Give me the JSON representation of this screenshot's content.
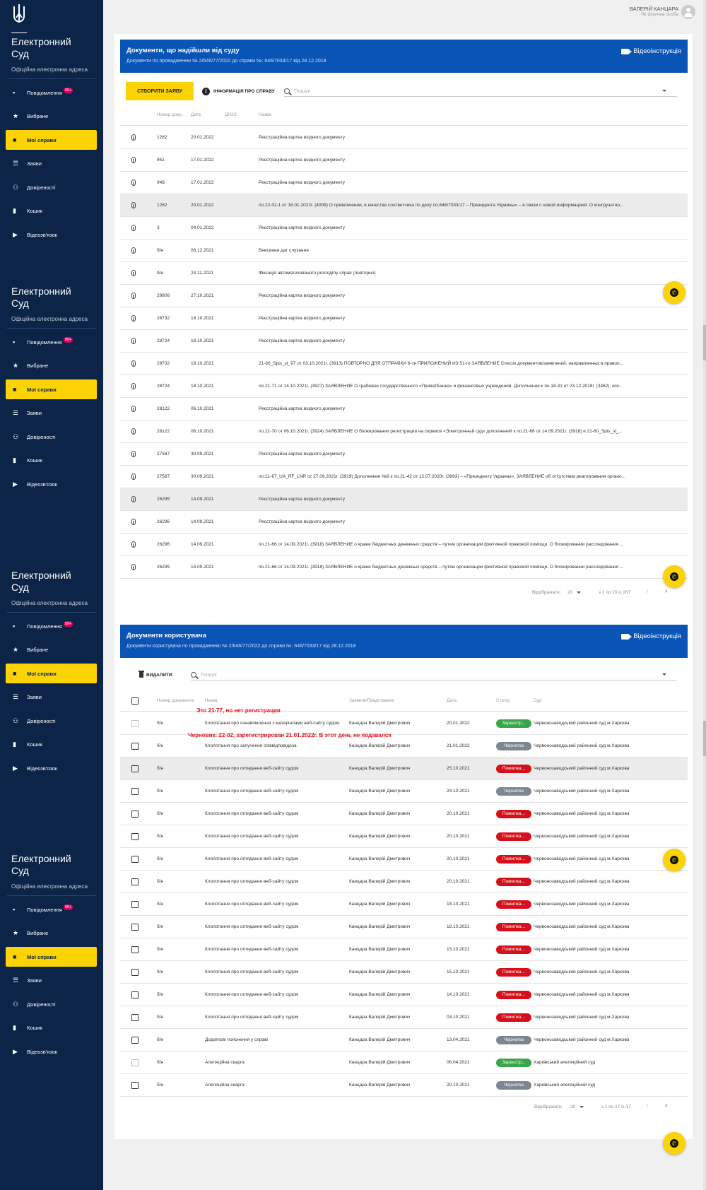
{
  "user": {
    "name": "ВАЛЕРІЙ КАНЦАРА",
    "role": "Як фізична особа"
  },
  "sidebar": {
    "title_line1": "Електронний",
    "title_line2": "Суд",
    "subtitle": "Офіційна електронна адреса",
    "badge": "99+",
    "items": [
      {
        "label": "Повідомлення",
        "icon": "message-icon"
      },
      {
        "label": "Вибране",
        "icon": "star-icon"
      },
      {
        "label": "Мої справи",
        "icon": "folder-icon",
        "active": true
      },
      {
        "label": "Заяви",
        "icon": "list-icon"
      },
      {
        "label": "Довіреності",
        "icon": "people-icon"
      },
      {
        "label": "Кошик",
        "icon": "trash-icon"
      },
      {
        "label": "Відеозв'язок",
        "icon": "video-icon"
      }
    ]
  },
  "court_docs": {
    "title": "Документи, що надійшли від суду",
    "subtitle": "Документи по провадженню № 2/646/77/2022 до справи №: 646/7033/17 від 28.12.2018",
    "video_label": "Відеоінструкція",
    "create_btn": "СТВОРИТИ ЗАЯВУ",
    "info_btn": "ІНФОРМАЦІЯ ПРО СПРАВУ",
    "search_placeholder": "Пошук",
    "columns": [
      "Номер доку...",
      "Дата",
      "ДНЗС",
      "Назва"
    ],
    "rows": [
      {
        "num": "1262",
        "date": "20.01.2022",
        "title": "Реєстраційна картка вхідного документу"
      },
      {
        "num": "951",
        "date": "17.01.2022",
        "title": "Реєстраційна картка вхідного документу"
      },
      {
        "num": "948",
        "date": "17.01.2022",
        "title": "Реєстраційна картка вхідного документу"
      },
      {
        "num": "1262",
        "date": "20.01.2022",
        "title": "по.22-02-1 от 16.01.2022г. (4009) О привлечении, в качестве соответчика по делу по.646/7033/17 – Президента Украины» – в связи с новой информацией. О конгруэнтно...",
        "sel": true
      },
      {
        "num": "3",
        "date": "04.01.2022",
        "title": "Реєстраційна картка вхідного документу"
      },
      {
        "num": "б/н",
        "date": "06.12.2021",
        "title": "Внесення дат слухання"
      },
      {
        "num": "б/н",
        "date": "24.11.2021",
        "title": "Фіксація автоматизованого розподілу справ (повторно)"
      },
      {
        "num": "29806",
        "date": "27.10.2021",
        "title": "Реєстраційна картка вхідного документу"
      },
      {
        "num": "28732",
        "date": "18.10.2021",
        "title": "Реєстраційна картка вхідного документу"
      },
      {
        "num": "28724",
        "date": "18.10.2021",
        "title": "Реєстраційна картка вхідного документу"
      },
      {
        "num": "28732",
        "date": "18.10.2021",
        "title": "21-60_Spis_st_97 от 03.10.2021г. (3913) ПОВТОРНО ДЛЯ ОТПРАВКИ 6-ти ПРИЛОЖЕНИЙ ИЗ 51-го ЗАЯВЛЕНИЕ Список документов/заявлений, направленных в правоо..."
      },
      {
        "num": "28724",
        "date": "18.10.2021",
        "title": "по.21-71 от 14.10.2021г. (3927) ЗАЯВЛЕНИЕ О грабежах государственного «ПриватБанка» и финансовых учреждений. Дополнение к по.18-31 от 23.12.2018г. (3462), иск..."
      },
      {
        "num": "28122",
        "date": "06.10.2021",
        "title": "Реєстраційна картка вхідного документу"
      },
      {
        "num": "28122",
        "date": "06.10.2021",
        "title": "по.21-70 от 06.10.2021г. (3924) ЗАЯВЛЕНИЕ О блокировании регистрации на сервисе «Электронный суд» дополнений к по.21-66 от 14.09.2021г. (3918) и 21-60_Spis_st_..."
      },
      {
        "num": "27587",
        "date": "30.09.2021",
        "title": "Реєстраційна картка вхідного документу"
      },
      {
        "num": "27587",
        "date": "30.09.2021",
        "title": "по.21-67_UA_RF_LNR от 27.09.2021г. (3919) Дополнение №9 к по.21-42 от 12.07.2020г. (3893) – «Президенту Украины». ЗАЯВЛЕНИЕ об отсутствии реагирования органо..."
      },
      {
        "num": "26295",
        "date": "14.09.2021",
        "title": "Реєстраційна картка вхідного документу",
        "sel": true
      },
      {
        "num": "26296",
        "date": "14.09.2021",
        "title": "Реєстраційна картка вхідного документу"
      },
      {
        "num": "26296",
        "date": "14.09.2021",
        "title": "по.21-66 от 14.09.2021г. (3918) ЗАЯВЛЕНИЕ о краже бюджетных денежных средств – путем организации фиктивной правовой помощи. О блокировании расследования ..."
      },
      {
        "num": "26295",
        "date": "14.09.2021",
        "title": "по.21-66 от 14.09.2021г. (3918) ЗАЯВЛЕНИЕ о краже бюджетных денежных средств – путем организации фиктивной правовой помощи. О блокировании расследования ..."
      }
    ],
    "pager": {
      "label": "Відображати:",
      "per_page": "20",
      "range": "з 1 по 20 із 267"
    }
  },
  "user_docs": {
    "title": "Документи користувача",
    "subtitle": "Документи користувача по провадженню № 2/646/77/2022 до справи №: 646/7033/17 від 28.12.2018",
    "video_label": "Відеоінструкція",
    "delete_btn": "ВИДАЛИТИ",
    "search_placeholder": "Пошук",
    "columns": [
      "Номер документа",
      "Назва",
      "Заявник/Представник",
      "Дата",
      "Статус",
      "Суд"
    ],
    "notes": [
      "Это 21-77, но нет регистрации",
      "Черновик: 22-02, зарегистрирован 21.01.2022г. В этот день не подавался"
    ],
    "rows": [
      {
        "num": "б/н",
        "title": "Клопотання про ознайомлення з матеріалами веб-сайту судом",
        "author": "Канцара Валерій Дмитрович",
        "date": "20.01.2022",
        "status": "Зареєстр...",
        "status_color": "#3aa54a",
        "court": "Червонозаводський районний суд м.Харкова",
        "cb_disabled": true
      },
      {
        "num": "б/н",
        "title": "Клопотання про залучення співвідповідача",
        "author": "Канцара Валерій Дмитрович",
        "date": "21.01.2022",
        "status": "Чернетка",
        "status_color": "#7d8791",
        "court": "Червонозаводський районний суд м.Харкова"
      },
      {
        "num": "б/н",
        "title": "Клопотання про оглядання веб-сайту судом",
        "author": "Канцара Валерій Дмитрович",
        "date": "25.10.2021",
        "status": "Помилка...",
        "status_color": "#d6101a",
        "court": "Червонозаводський районний суд м.Харкова",
        "sel": true
      },
      {
        "num": "б/н",
        "title": "Клопотання про оглядання веб-сайту судом",
        "author": "Канцара Валерій Дмитрович",
        "date": "24.10.2021",
        "status": "Чернетка",
        "status_color": "#7d8791",
        "court": "Червонозаводський районний суд м.Харкова"
      },
      {
        "num": "б/н",
        "title": "Клопотання про оглядання веб-сайту судом",
        "author": "Канцара Валерій Дмитрович",
        "date": "20.10.2021",
        "status": "Помилка...",
        "status_color": "#d6101a",
        "court": "Червонозаводський районний суд м.Харкова"
      },
      {
        "num": "б/н",
        "title": "Клопотання про оглядання веб-сайту судом",
        "author": "Канцара Валерій Дмитрович",
        "date": "20.10.2021",
        "status": "Помилка...",
        "status_color": "#d6101a",
        "court": "Червонозаводський районний суд м.Харкова"
      },
      {
        "num": "б/н",
        "title": "Клопотання про оглядання веб-сайту судом",
        "author": "Канцара Валерій Дмитрович",
        "date": "20.10.2021",
        "status": "Помилка...",
        "status_color": "#d6101a",
        "court": "Червонозаводський районний суд м.Харкова"
      },
      {
        "num": "б/н",
        "title": "Клопотання про оглядання веб-сайту судом",
        "author": "Канцара Валерій Дмитрович",
        "date": "20.10.2021",
        "status": "Помилка...",
        "status_color": "#d6101a",
        "court": "Червонозаводський районний суд м.Харкова"
      },
      {
        "num": "б/н",
        "title": "Клопотання про оглядання веб-сайту судом",
        "author": "Канцара Валерій Дмитрович",
        "date": "18.10.2021",
        "status": "Помилка...",
        "status_color": "#d6101a",
        "court": "Червонозаводський районний суд м.Харкова"
      },
      {
        "num": "б/н",
        "title": "Клопотання про оглядання веб-сайту судом",
        "author": "Канцара Валерій Дмитрович",
        "date": "18.10.2021",
        "status": "Помилка...",
        "status_color": "#d6101a",
        "court": "Червонозаводський районний суд м.Харкова"
      },
      {
        "num": "б/н",
        "title": "Клопотання про оглядання веб-сайту судом",
        "author": "Канцара Валерій Дмитрович",
        "date": "15.10.2021",
        "status": "Помилка...",
        "status_color": "#d6101a",
        "court": "Червонозаводський районний суд м.Харкова"
      },
      {
        "num": "б/н",
        "title": "Клопотання про оглядання веб-сайту судом",
        "author": "Канцара Валерій Дмитрович",
        "date": "15.10.2021",
        "status": "Помилка...",
        "status_color": "#d6101a",
        "court": "Червонозаводський районний суд м.Харкова"
      },
      {
        "num": "б/н",
        "title": "Клопотання про оглядання веб-сайту судом",
        "author": "Канцара Валерій Дмитрович",
        "date": "14.10.2021",
        "status": "Помилка...",
        "status_color": "#d6101a",
        "court": "Червонозаводський районний суд м.Харкова"
      },
      {
        "num": "б/н",
        "title": "Клопотання про оглядання веб-сайту судом",
        "author": "Канцара Валерій Дмитрович",
        "date": "03.10.2021",
        "status": "Помилка...",
        "status_color": "#d6101a",
        "court": "Червонозаводський районний суд м.Харкова"
      },
      {
        "num": "б/н",
        "title": "Додаткові пояснення у справі",
        "author": "Канцара Валерій Дмитрович",
        "date": "13.04.2021",
        "status": "Чернетка",
        "status_color": "#7d8791",
        "court": "Червонозаводський районний суд м.Харкова"
      },
      {
        "num": "б/н",
        "title": "Апеляційна скарга",
        "author": "Канцара Валерій Дмитрович",
        "date": "06.04.2021",
        "status": "Зареєстр...",
        "status_color": "#3aa54a",
        "court": "Харківський апеляційний суд",
        "cb_disabled": true
      },
      {
        "num": "б/н",
        "title": "Апеляційна скарга",
        "author": "Канцара Валерій Дмитрович",
        "date": "20.10.2021",
        "status": "Чернетка",
        "status_color": "#7d8791",
        "court": "Харківський апеляційний суд"
      }
    ],
    "pager": {
      "label": "Відображати:",
      "per_page": "20",
      "range": "з 1 по 17 із 17"
    }
  },
  "colors": {
    "sidebar": "#0c2448",
    "accent": "#fcd305",
    "header": "#0a54b5"
  }
}
